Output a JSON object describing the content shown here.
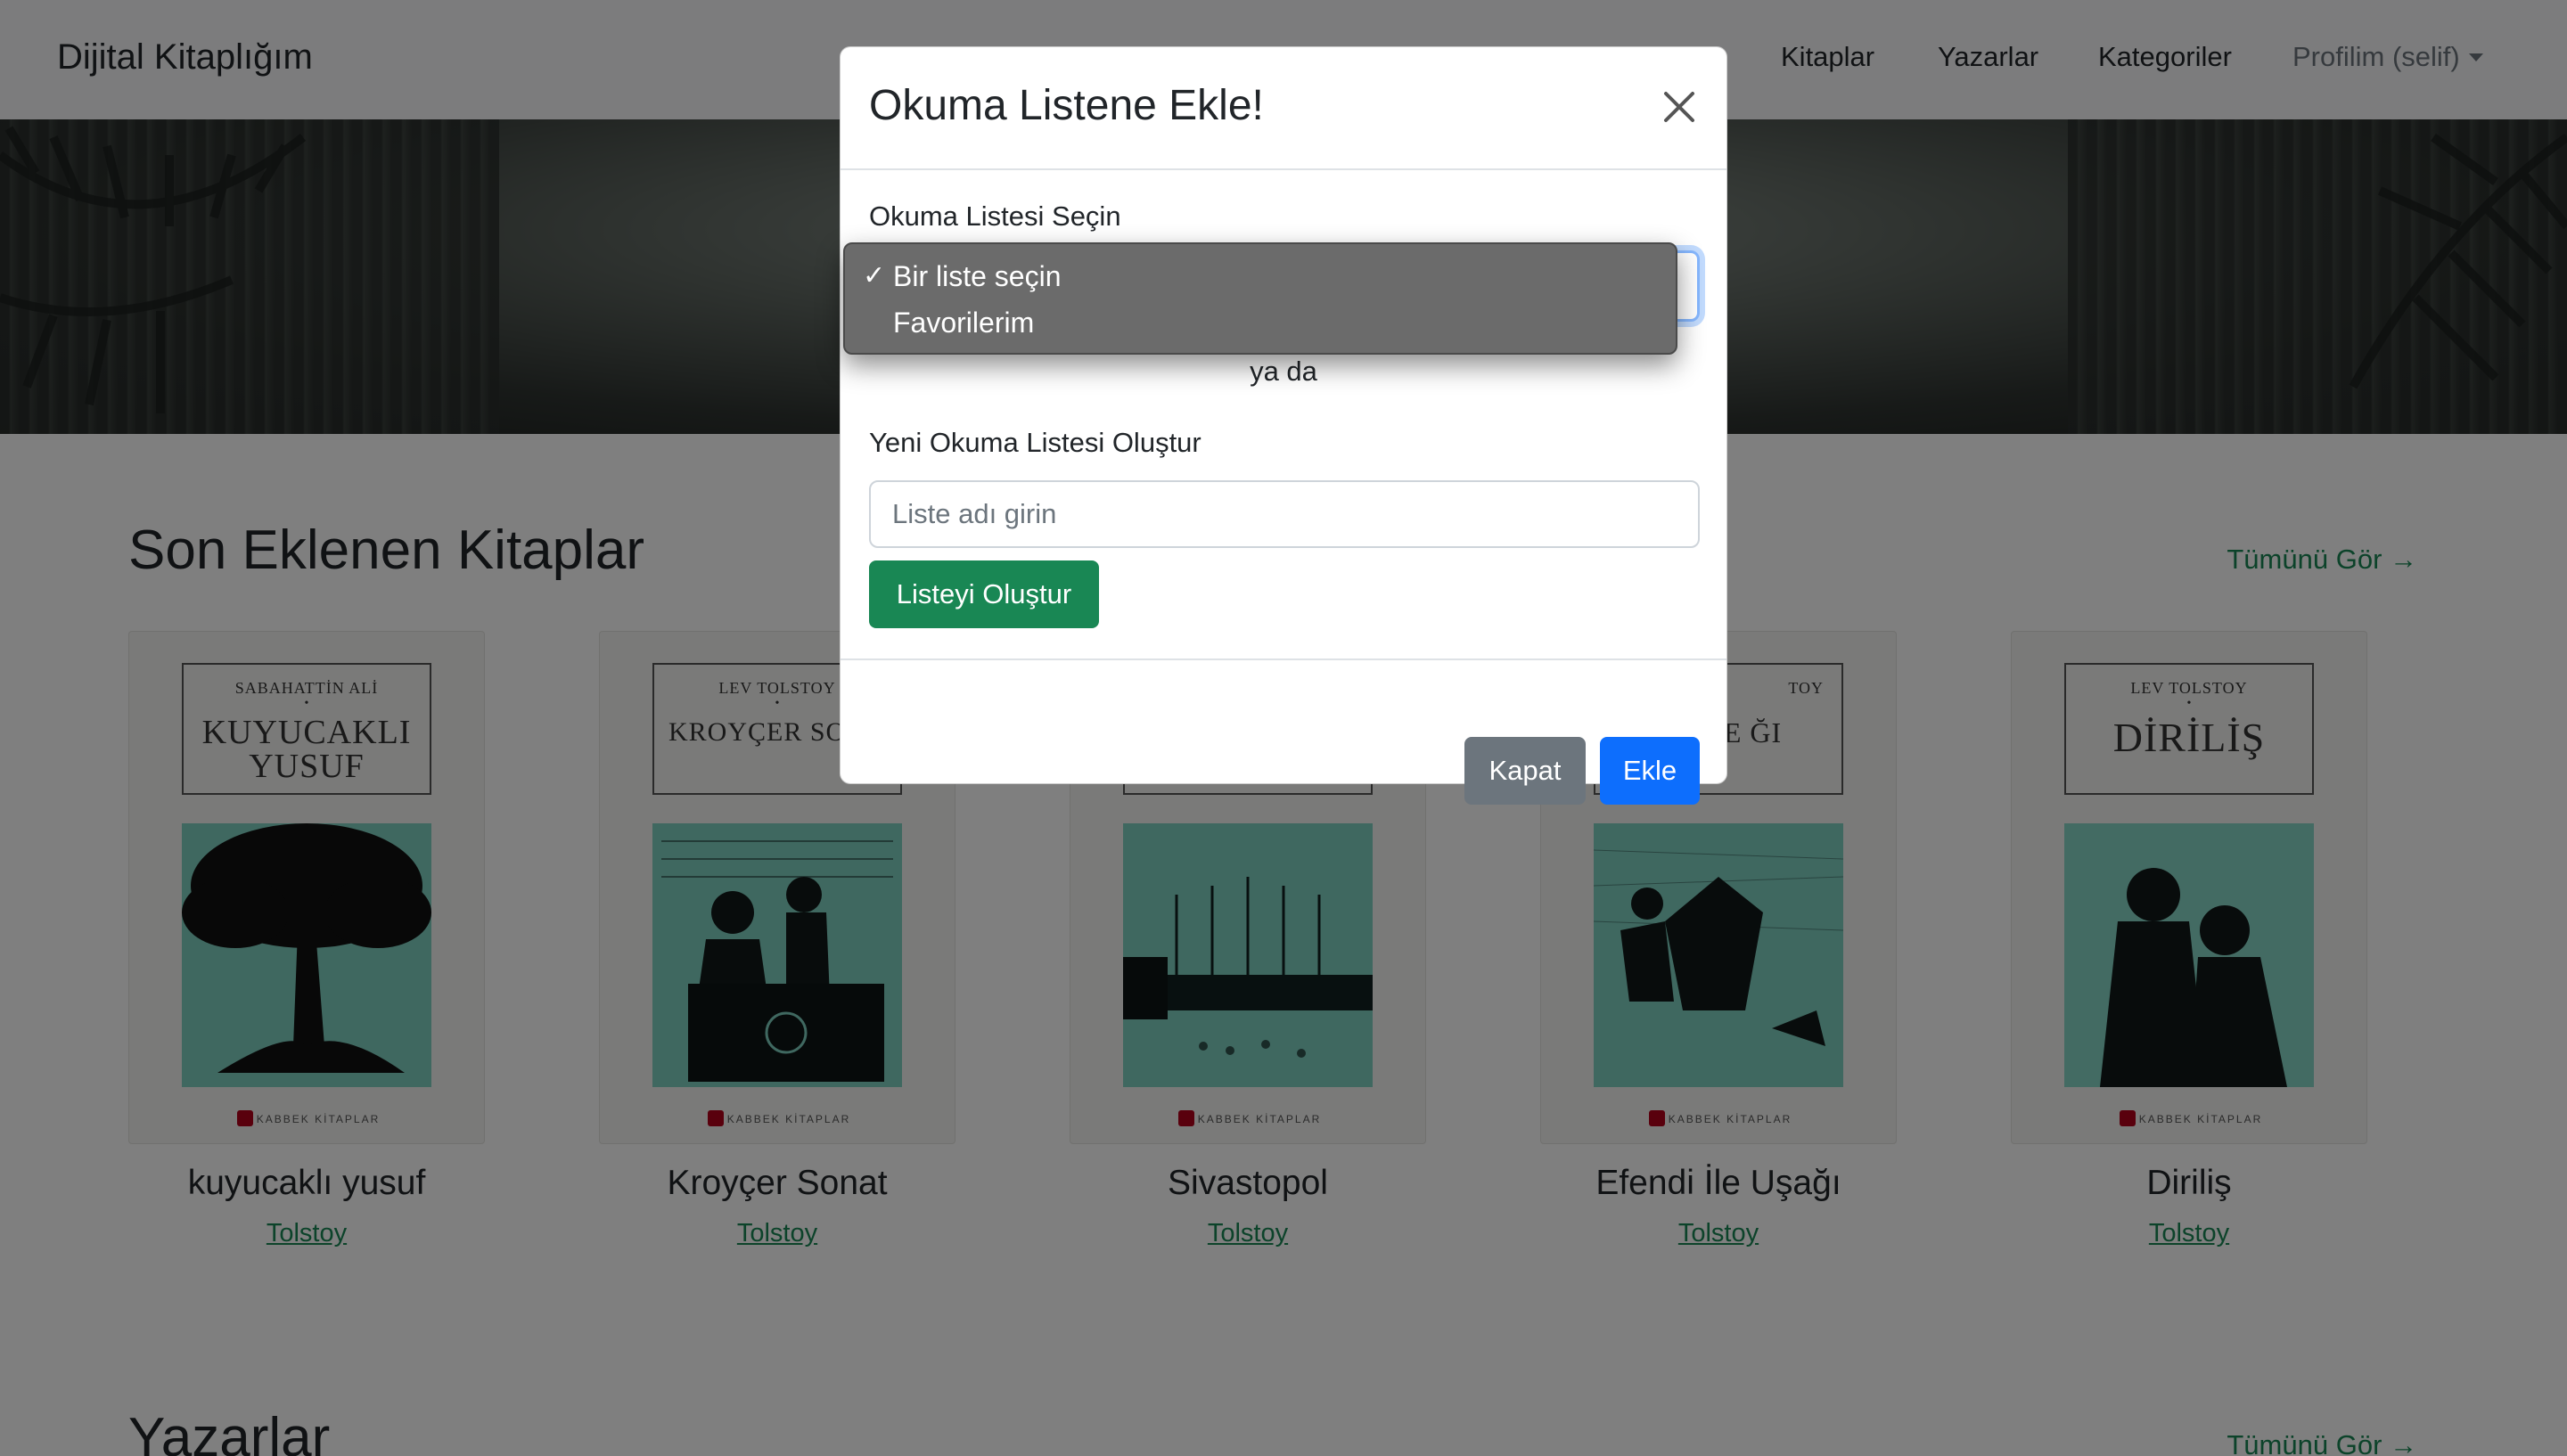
{
  "navbar": {
    "brand": "Dijital Kitaplığım",
    "links": [
      {
        "label": "Kitaplar"
      },
      {
        "label": "Yazarlar"
      },
      {
        "label": "Kategoriler"
      },
      {
        "label": "Profilim (selif)"
      }
    ]
  },
  "latest": {
    "title": "Son Eklenen Kitaplar",
    "see_all": "Tümünü Gör →",
    "books": [
      {
        "title": "kuyucaklı yusuf",
        "author": "Tolstoy",
        "cover_author": "SABAHATTİN ALİ",
        "cover_title": "KUYUCAKLI YUSUF"
      },
      {
        "title": "Kroyçer Sonat",
        "author": "Tolstoy",
        "cover_author": "LEV TOLSTOY",
        "cover_title": "KROYÇER SON"
      },
      {
        "title": "Sivastopol",
        "author": "Tolstoy",
        "cover_author": "",
        "cover_title": ""
      },
      {
        "title": "Efendi İle Uşağı",
        "author": "Tolstoy",
        "cover_author": "TOY",
        "cover_title": "Dİ İLE ĞI"
      },
      {
        "title": "Diriliş",
        "author": "Tolstoy",
        "cover_author": "LEV TOLSTOY",
        "cover_title": "DİRİLİŞ"
      }
    ],
    "publisher": "KABBEK KİTAPLAR"
  },
  "authors_section": {
    "title": "Yazarlar",
    "see_all": "Tümünü Gör →"
  },
  "modal": {
    "title": "Okuma Listene Ekle!",
    "select_label": "Okuma Listesi Seçin",
    "select_options": [
      {
        "label": "Bir liste seçin",
        "selected": true
      },
      {
        "label": "Favorilerim",
        "selected": false
      }
    ],
    "or_text": "ya da",
    "new_list_label": "Yeni Okuma Listesi Oluştur",
    "new_list_placeholder": "Liste adı girin",
    "create_button": "Listeyi Oluştur",
    "close_button": "Kapat",
    "add_button": "Ekle"
  },
  "colors": {
    "primary": "#0d6efd",
    "success": "#198754",
    "secondary": "#6c757d"
  }
}
